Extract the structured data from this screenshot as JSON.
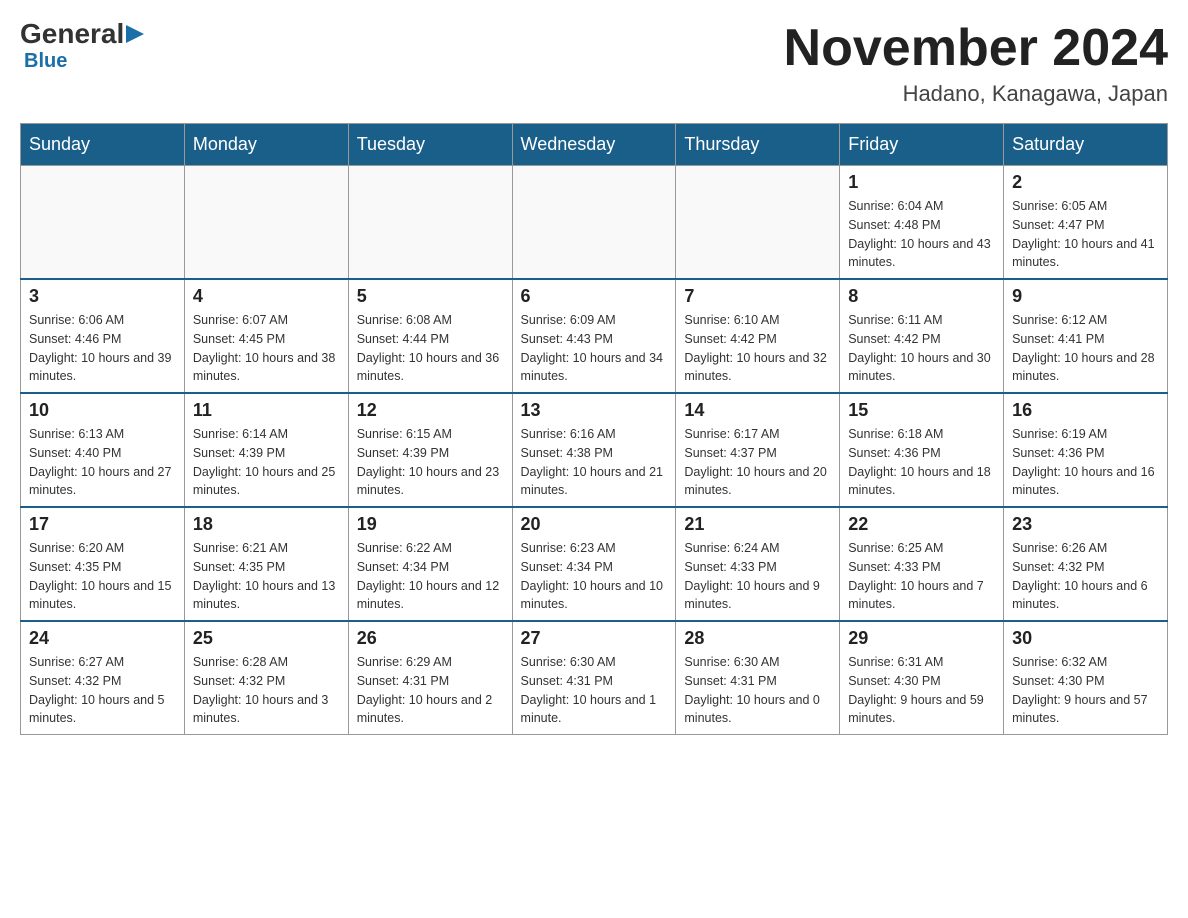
{
  "header": {
    "logo": {
      "general": "General",
      "blue": "Blue"
    },
    "title": "November 2024",
    "location": "Hadano, Kanagawa, Japan"
  },
  "days_of_week": [
    "Sunday",
    "Monday",
    "Tuesday",
    "Wednesday",
    "Thursday",
    "Friday",
    "Saturday"
  ],
  "weeks": [
    [
      {
        "day": "",
        "info": ""
      },
      {
        "day": "",
        "info": ""
      },
      {
        "day": "",
        "info": ""
      },
      {
        "day": "",
        "info": ""
      },
      {
        "day": "",
        "info": ""
      },
      {
        "day": "1",
        "info": "Sunrise: 6:04 AM\nSunset: 4:48 PM\nDaylight: 10 hours and 43 minutes."
      },
      {
        "day": "2",
        "info": "Sunrise: 6:05 AM\nSunset: 4:47 PM\nDaylight: 10 hours and 41 minutes."
      }
    ],
    [
      {
        "day": "3",
        "info": "Sunrise: 6:06 AM\nSunset: 4:46 PM\nDaylight: 10 hours and 39 minutes."
      },
      {
        "day": "4",
        "info": "Sunrise: 6:07 AM\nSunset: 4:45 PM\nDaylight: 10 hours and 38 minutes."
      },
      {
        "day": "5",
        "info": "Sunrise: 6:08 AM\nSunset: 4:44 PM\nDaylight: 10 hours and 36 minutes."
      },
      {
        "day": "6",
        "info": "Sunrise: 6:09 AM\nSunset: 4:43 PM\nDaylight: 10 hours and 34 minutes."
      },
      {
        "day": "7",
        "info": "Sunrise: 6:10 AM\nSunset: 4:42 PM\nDaylight: 10 hours and 32 minutes."
      },
      {
        "day": "8",
        "info": "Sunrise: 6:11 AM\nSunset: 4:42 PM\nDaylight: 10 hours and 30 minutes."
      },
      {
        "day": "9",
        "info": "Sunrise: 6:12 AM\nSunset: 4:41 PM\nDaylight: 10 hours and 28 minutes."
      }
    ],
    [
      {
        "day": "10",
        "info": "Sunrise: 6:13 AM\nSunset: 4:40 PM\nDaylight: 10 hours and 27 minutes."
      },
      {
        "day": "11",
        "info": "Sunrise: 6:14 AM\nSunset: 4:39 PM\nDaylight: 10 hours and 25 minutes."
      },
      {
        "day": "12",
        "info": "Sunrise: 6:15 AM\nSunset: 4:39 PM\nDaylight: 10 hours and 23 minutes."
      },
      {
        "day": "13",
        "info": "Sunrise: 6:16 AM\nSunset: 4:38 PM\nDaylight: 10 hours and 21 minutes."
      },
      {
        "day": "14",
        "info": "Sunrise: 6:17 AM\nSunset: 4:37 PM\nDaylight: 10 hours and 20 minutes."
      },
      {
        "day": "15",
        "info": "Sunrise: 6:18 AM\nSunset: 4:36 PM\nDaylight: 10 hours and 18 minutes."
      },
      {
        "day": "16",
        "info": "Sunrise: 6:19 AM\nSunset: 4:36 PM\nDaylight: 10 hours and 16 minutes."
      }
    ],
    [
      {
        "day": "17",
        "info": "Sunrise: 6:20 AM\nSunset: 4:35 PM\nDaylight: 10 hours and 15 minutes."
      },
      {
        "day": "18",
        "info": "Sunrise: 6:21 AM\nSunset: 4:35 PM\nDaylight: 10 hours and 13 minutes."
      },
      {
        "day": "19",
        "info": "Sunrise: 6:22 AM\nSunset: 4:34 PM\nDaylight: 10 hours and 12 minutes."
      },
      {
        "day": "20",
        "info": "Sunrise: 6:23 AM\nSunset: 4:34 PM\nDaylight: 10 hours and 10 minutes."
      },
      {
        "day": "21",
        "info": "Sunrise: 6:24 AM\nSunset: 4:33 PM\nDaylight: 10 hours and 9 minutes."
      },
      {
        "day": "22",
        "info": "Sunrise: 6:25 AM\nSunset: 4:33 PM\nDaylight: 10 hours and 7 minutes."
      },
      {
        "day": "23",
        "info": "Sunrise: 6:26 AM\nSunset: 4:32 PM\nDaylight: 10 hours and 6 minutes."
      }
    ],
    [
      {
        "day": "24",
        "info": "Sunrise: 6:27 AM\nSunset: 4:32 PM\nDaylight: 10 hours and 5 minutes."
      },
      {
        "day": "25",
        "info": "Sunrise: 6:28 AM\nSunset: 4:32 PM\nDaylight: 10 hours and 3 minutes."
      },
      {
        "day": "26",
        "info": "Sunrise: 6:29 AM\nSunset: 4:31 PM\nDaylight: 10 hours and 2 minutes."
      },
      {
        "day": "27",
        "info": "Sunrise: 6:30 AM\nSunset: 4:31 PM\nDaylight: 10 hours and 1 minute."
      },
      {
        "day": "28",
        "info": "Sunrise: 6:30 AM\nSunset: 4:31 PM\nDaylight: 10 hours and 0 minutes."
      },
      {
        "day": "29",
        "info": "Sunrise: 6:31 AM\nSunset: 4:30 PM\nDaylight: 9 hours and 59 minutes."
      },
      {
        "day": "30",
        "info": "Sunrise: 6:32 AM\nSunset: 4:30 PM\nDaylight: 9 hours and 57 minutes."
      }
    ]
  ]
}
